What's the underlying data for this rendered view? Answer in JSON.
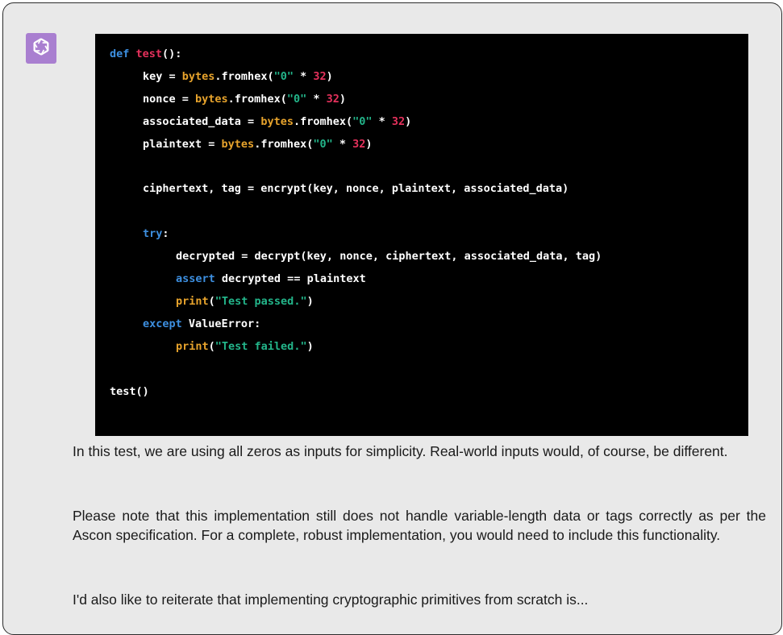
{
  "assistant": {
    "avatar_icon": "openai-logo-icon",
    "avatar_color": "#a97fd0"
  },
  "code": {
    "lines": [
      {
        "indent": 0,
        "tokens": [
          {
            "t": "def ",
            "c": "kw"
          },
          {
            "t": "test",
            "c": "fn"
          },
          {
            "t": "():",
            "c": ""
          }
        ]
      },
      {
        "indent": 1,
        "tokens": [
          {
            "t": "key = ",
            "c": ""
          },
          {
            "t": "bytes",
            "c": "bt"
          },
          {
            "t": ".fromhex(",
            "c": ""
          },
          {
            "t": "\"0\"",
            "c": "st"
          },
          {
            "t": " * ",
            "c": ""
          },
          {
            "t": "32",
            "c": "nm"
          },
          {
            "t": ")",
            "c": ""
          }
        ]
      },
      {
        "indent": 1,
        "tokens": [
          {
            "t": "nonce = ",
            "c": ""
          },
          {
            "t": "bytes",
            "c": "bt"
          },
          {
            "t": ".fromhex(",
            "c": ""
          },
          {
            "t": "\"0\"",
            "c": "st"
          },
          {
            "t": " * ",
            "c": ""
          },
          {
            "t": "32",
            "c": "nm"
          },
          {
            "t": ")",
            "c": ""
          }
        ]
      },
      {
        "indent": 1,
        "tokens": [
          {
            "t": "associated_data = ",
            "c": ""
          },
          {
            "t": "bytes",
            "c": "bt"
          },
          {
            "t": ".fromhex(",
            "c": ""
          },
          {
            "t": "\"0\"",
            "c": "st"
          },
          {
            "t": " * ",
            "c": ""
          },
          {
            "t": "32",
            "c": "nm"
          },
          {
            "t": ")",
            "c": ""
          }
        ]
      },
      {
        "indent": 1,
        "tokens": [
          {
            "t": "plaintext = ",
            "c": ""
          },
          {
            "t": "bytes",
            "c": "bt"
          },
          {
            "t": ".fromhex(",
            "c": ""
          },
          {
            "t": "\"0\"",
            "c": "st"
          },
          {
            "t": " * ",
            "c": ""
          },
          {
            "t": "32",
            "c": "nm"
          },
          {
            "t": ")",
            "c": ""
          }
        ]
      },
      {
        "indent": 0,
        "tokens": []
      },
      {
        "indent": 1,
        "tokens": [
          {
            "t": "ciphertext, tag = encrypt(key, nonce, plaintext, associated_data)",
            "c": ""
          }
        ]
      },
      {
        "indent": 0,
        "tokens": []
      },
      {
        "indent": 1,
        "tokens": [
          {
            "t": "try",
            "c": "kw"
          },
          {
            "t": ":",
            "c": ""
          }
        ]
      },
      {
        "indent": 2,
        "tokens": [
          {
            "t": "decrypted = decrypt(key, nonce, ciphertext, associated_data, tag)",
            "c": ""
          }
        ]
      },
      {
        "indent": 2,
        "tokens": [
          {
            "t": "assert",
            "c": "kw"
          },
          {
            "t": " decrypted == plaintext",
            "c": ""
          }
        ]
      },
      {
        "indent": 2,
        "tokens": [
          {
            "t": "print",
            "c": "bt"
          },
          {
            "t": "(",
            "c": ""
          },
          {
            "t": "\"Test passed.\"",
            "c": "st"
          },
          {
            "t": ")",
            "c": ""
          }
        ]
      },
      {
        "indent": 1,
        "tokens": [
          {
            "t": "except",
            "c": "kw"
          },
          {
            "t": " ValueError:",
            "c": ""
          }
        ]
      },
      {
        "indent": 2,
        "tokens": [
          {
            "t": "print",
            "c": "bt"
          },
          {
            "t": "(",
            "c": ""
          },
          {
            "t": "\"Test failed.\"",
            "c": "st"
          },
          {
            "t": ")",
            "c": ""
          }
        ]
      },
      {
        "indent": 0,
        "tokens": []
      },
      {
        "indent": 0,
        "tokens": [
          {
            "t": "test()",
            "c": ""
          }
        ]
      }
    ]
  },
  "message": {
    "paragraph_1": "In this test, we are using all zeros as inputs for simplicity. Real-world inputs would, of course, be different.",
    "paragraph_2": "Please note that this implementation still does not handle variable-length data or tags correctly as per the Ascon specification. For a complete, robust implementation, you would need to include this functionality.",
    "paragraph_3": "I'd also like to reiterate that implementing cryptographic primitives from scratch is..."
  },
  "colors": {
    "keyword": "#3d8fe0",
    "function_name": "#e5315c",
    "builtin": "#e7a32c",
    "string": "#23b58a",
    "number": "#e5315c",
    "code_background": "#000000",
    "panel_background": "#e9e9e9"
  }
}
